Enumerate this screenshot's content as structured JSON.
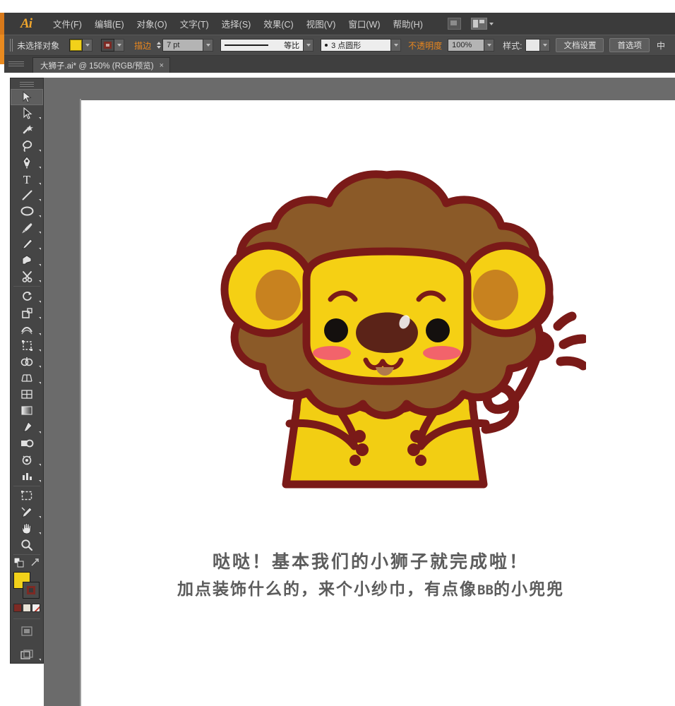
{
  "app": {
    "name": "Adobe Illustrator",
    "logo_text": "Ai"
  },
  "menubar": {
    "items": [
      {
        "label": "文件(F)",
        "name": "menu-file"
      },
      {
        "label": "编辑(E)",
        "name": "menu-edit"
      },
      {
        "label": "对象(O)",
        "name": "menu-object"
      },
      {
        "label": "文字(T)",
        "name": "menu-type"
      },
      {
        "label": "选择(S)",
        "name": "menu-select"
      },
      {
        "label": "效果(C)",
        "name": "menu-effect"
      },
      {
        "label": "视图(V)",
        "name": "menu-view"
      },
      {
        "label": "窗口(W)",
        "name": "menu-window"
      },
      {
        "label": "帮助(H)",
        "name": "menu-help"
      }
    ]
  },
  "controlbar": {
    "selection_status": "未选择对象",
    "fill_color": "#F2D11A",
    "stroke_color": "#7D2A24",
    "stroke_label": "描边",
    "stroke_weight": "7 pt",
    "stroke_profile_label": "等比",
    "brush_label": "3 点圆形",
    "opacity_label": "不透明度",
    "opacity_value": "100%",
    "style_label": "样式:",
    "doc_setup_button": "文档设置",
    "preferences_button": "首选项",
    "overflow_hint": "中"
  },
  "tabbar": {
    "document_tab": "大狮子.ai* @ 150% (RGB/预览)",
    "close_glyph": "×"
  },
  "tools": [
    {
      "name": "selection-tool",
      "title": "选择工具",
      "selected": true
    },
    {
      "name": "direct-selection-tool",
      "title": "直接选择工具",
      "selected": false
    },
    {
      "name": "magic-wand-tool",
      "title": "魔棒工具",
      "selected": false
    },
    {
      "name": "lasso-tool",
      "title": "套索工具",
      "selected": false
    },
    {
      "name": "pen-tool",
      "title": "钢笔工具",
      "selected": false
    },
    {
      "name": "type-tool",
      "title": "文字工具",
      "selected": false
    },
    {
      "name": "line-segment-tool",
      "title": "直线段工具",
      "selected": false
    },
    {
      "name": "ellipse-tool",
      "title": "椭圆工具",
      "selected": false
    },
    {
      "name": "paintbrush-tool",
      "title": "画笔工具",
      "selected": false
    },
    {
      "name": "pencil-tool",
      "title": "铅笔工具",
      "selected": false
    },
    {
      "name": "blob-brush-tool",
      "title": "斑点画笔工具",
      "selected": false
    },
    {
      "name": "eraser-tool",
      "title": "橡皮擦工具",
      "selected": false
    },
    {
      "name": "scissors-tool",
      "title": "剪刀工具",
      "selected": false
    },
    {
      "name": "rotate-tool",
      "title": "旋转工具",
      "selected": false
    },
    {
      "name": "scale-tool",
      "title": "比例缩放工具",
      "selected": false
    },
    {
      "name": "width-tool",
      "title": "宽度工具",
      "selected": false
    },
    {
      "name": "free-transform-tool",
      "title": "自由变换工具",
      "selected": false
    },
    {
      "name": "shape-builder-tool",
      "title": "形状生成器工具",
      "selected": false
    },
    {
      "name": "perspective-grid-tool",
      "title": "透视网格工具",
      "selected": false
    },
    {
      "name": "mesh-tool",
      "title": "网格工具",
      "selected": false
    },
    {
      "name": "gradient-tool",
      "title": "渐变工具",
      "selected": false
    },
    {
      "name": "eyedropper-tool",
      "title": "吸管工具",
      "selected": false
    },
    {
      "name": "blend-tool",
      "title": "混合工具",
      "selected": false
    },
    {
      "name": "symbol-sprayer-tool",
      "title": "符号喷枪工具",
      "selected": false
    },
    {
      "name": "column-graph-tool",
      "title": "柱形图工具",
      "selected": false
    },
    {
      "name": "artboard-tool",
      "title": "画板工具",
      "selected": false
    },
    {
      "name": "slice-tool",
      "title": "切片工具",
      "selected": false
    },
    {
      "name": "hand-tool",
      "title": "抓手工具",
      "selected": false
    },
    {
      "name": "zoom-tool",
      "title": "缩放工具",
      "selected": false
    }
  ],
  "tool_footer": {
    "fill_color": "#F2D11A",
    "stroke_color": "#7D2A24",
    "color_button": "颜色",
    "gradient_button": "渐变",
    "none_button": "无",
    "screen_mode": "更改屏幕模式"
  },
  "artwork": {
    "title": "卡通小狮子",
    "colors": {
      "body_yellow": "#F2CE13",
      "face_yellow": "#F5D014",
      "mane_brown": "#8B5A28",
      "ear_inner": "#C8821F",
      "outline_dark_red": "#7A1A18",
      "nose_brown": "#5B2318",
      "cheek_pink": "#F2636B",
      "tongue_brown": "#B07A4E",
      "collar_green": "#45BB4A",
      "eye_black": "#14100E"
    }
  },
  "caption": {
    "line1": "哒哒！基本我们的小狮子就完成啦！",
    "line2_before": "加点装饰什么的，来个小纱巾，有点像",
    "line2_bb": "BB",
    "line2_after": "的小兜兜"
  }
}
